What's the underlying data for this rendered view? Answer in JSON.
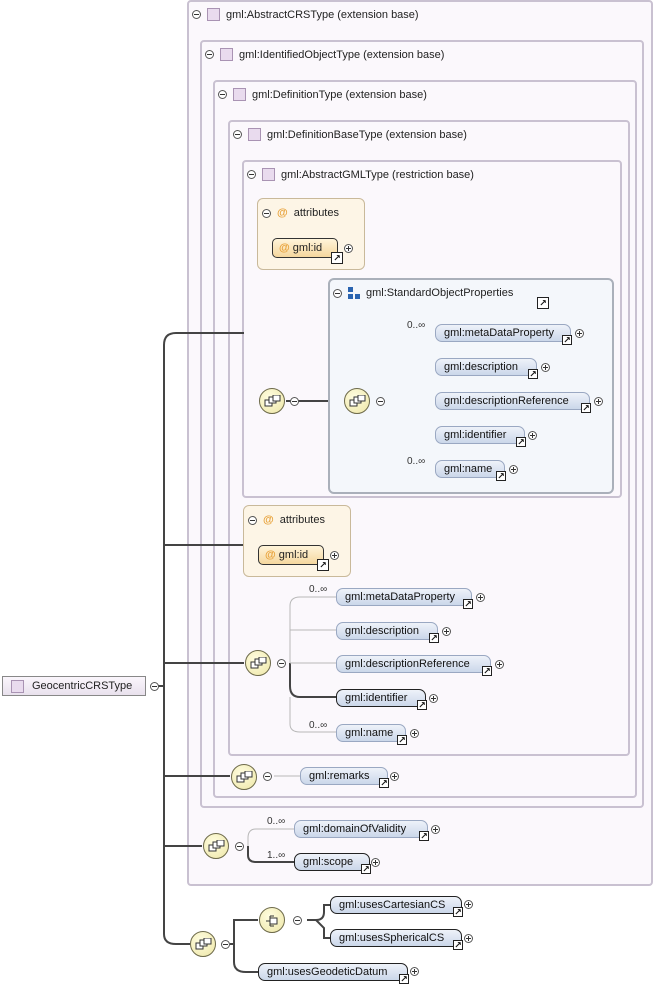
{
  "root": {
    "label": "GeocentricCRSType"
  },
  "extensions": [
    {
      "label": "gml:AbstractCRSType (extension base)"
    },
    {
      "label": "gml:IdentifiedObjectType (extension base)"
    },
    {
      "label": "gml:DefinitionType (extension base)"
    },
    {
      "label": "gml:DefinitionBaseType (extension base)"
    },
    {
      "label": "gml:AbstractGMLType (restriction base)"
    }
  ],
  "attributes_inner": {
    "label": "attributes",
    "item": "gml:id"
  },
  "attributes_outer": {
    "label": "attributes",
    "item": "gml:id"
  },
  "group": {
    "label": "gml:StandardObjectProperties"
  },
  "group_elements": [
    {
      "label": "gml:metaDataProperty",
      "card": "0..∞"
    },
    {
      "label": "gml:description",
      "card": ""
    },
    {
      "label": "gml:descriptionReference",
      "card": ""
    },
    {
      "label": "gml:identifier",
      "card": ""
    },
    {
      "label": "gml:name",
      "card": "0..∞"
    }
  ],
  "def_elements": [
    {
      "label": "gml:metaDataProperty",
      "card": "0..∞"
    },
    {
      "label": "gml:description",
      "card": ""
    },
    {
      "label": "gml:descriptionReference",
      "card": ""
    },
    {
      "label": "gml:identifier",
      "card": ""
    },
    {
      "label": "gml:name",
      "card": "0..∞"
    }
  ],
  "remarks": {
    "label": "gml:remarks"
  },
  "crs_elements": [
    {
      "label": "gml:domainOfValidity",
      "card": "0..∞"
    },
    {
      "label": "gml:scope",
      "card": "1..∞"
    }
  ],
  "choice_elements": [
    {
      "label": "gml:usesCartesianCS"
    },
    {
      "label": "gml:usesSphericalCS"
    }
  ],
  "datum": {
    "label": "gml:usesGeodeticDatum"
  },
  "colors": {
    "box_border": "#c9c1d1",
    "element_fill": "#cbd7ea",
    "attribute_fill": "#f5d79e",
    "compositor_fill": "#ede6a6"
  }
}
